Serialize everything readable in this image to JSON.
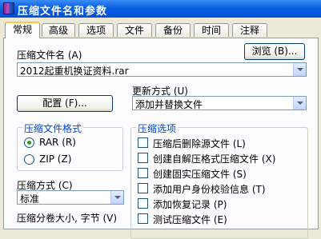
{
  "window": {
    "title": "压缩文件名和参数"
  },
  "tabs": [
    {
      "label": "常规",
      "active": true
    },
    {
      "label": "高级"
    },
    {
      "label": "选项"
    },
    {
      "label": "文件"
    },
    {
      "label": "备份"
    },
    {
      "label": "时间"
    },
    {
      "label": "注释"
    }
  ],
  "general": {
    "archive_name_label": "压缩文件名 (A)",
    "browse_label": "浏览 (B)...",
    "archive_name_value": "2012起重机换证资料.rar",
    "update_mode_label": "更新方式 (U)",
    "profiles_label": "配置 (F)...",
    "update_mode_value": "添加并替换文件",
    "format_group_title": "压缩文件格式",
    "format_options": [
      {
        "label": "RAR (R)",
        "selected": true
      },
      {
        "label": "ZIP (Z)",
        "selected": false
      }
    ],
    "options_group_title": "压缩选项",
    "options": [
      {
        "label": "压缩后删除源文件 (L)",
        "checked": false
      },
      {
        "label": "创建自解压格式压缩文件 (X)",
        "checked": false
      },
      {
        "label": "创建固实压缩文件 (S)",
        "checked": false
      },
      {
        "label": "添加用户身份校验信息 (T)",
        "checked": false
      },
      {
        "label": "添加恢复记录 (P)",
        "checked": false
      },
      {
        "label": "测试压缩文件 (E)",
        "checked": false
      }
    ],
    "method_label": "压缩方式 (C)",
    "method_value": "标准",
    "split_label": "压缩分卷大小, 字节 (V)"
  }
}
